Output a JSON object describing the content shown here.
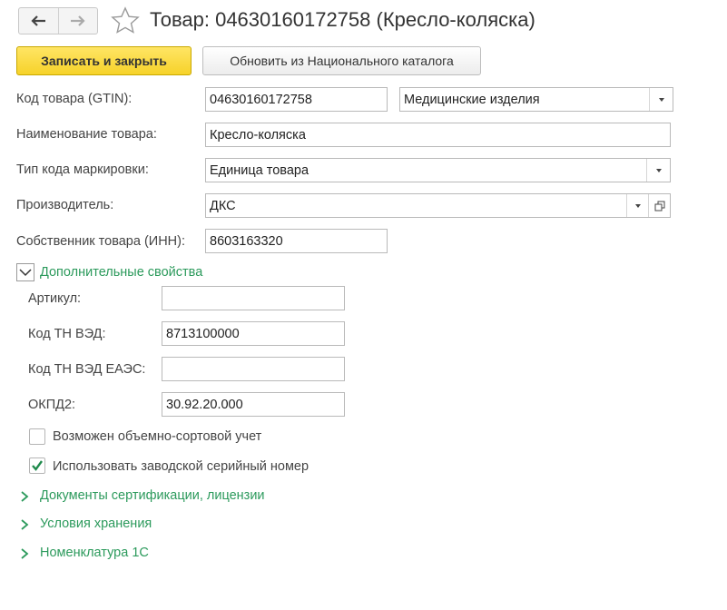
{
  "window": {
    "title": "Товар: 04630160172758 (Кресло-коляска)"
  },
  "toolbar": {
    "save_close_label": "Записать и закрыть",
    "update_label": "Обновить из Национального каталога"
  },
  "fields": {
    "gtin": {
      "label": "Код товара (GTIN):",
      "value": "04630160172758",
      "category": "Медицинские изделия"
    },
    "name": {
      "label": "Наименование товара:",
      "value": "Кресло-коляска"
    },
    "marking_type": {
      "label": "Тип кода маркировки:",
      "value": "Единица товара"
    },
    "manufacturer": {
      "label": "Производитель:",
      "value": "ДКС"
    },
    "owner_inn": {
      "label": "Собственник товара (ИНН):",
      "value": "8603163320"
    }
  },
  "extra": {
    "header": "Дополнительные свойства",
    "article": {
      "label": "Артикул:",
      "value": ""
    },
    "tnved": {
      "label": "Код ТН ВЭД:",
      "value": "8713100000"
    },
    "tnved_eaes": {
      "label": "Код ТН ВЭД ЕАЭС:",
      "value": ""
    },
    "okpd2": {
      "label": "ОКПД2:",
      "value": "30.92.20.000"
    },
    "bulk_accounting": {
      "label": "Возможен объемно-сортовой учет",
      "checked": false
    },
    "factory_serial": {
      "label": "Использовать заводской серийный номер",
      "checked": true
    }
  },
  "sections": [
    {
      "label": "Документы сертификации, лицензии"
    },
    {
      "label": "Условия хранения"
    },
    {
      "label": "Номенклатура 1С"
    }
  ],
  "colors": {
    "accent_green": "#2c9a5c",
    "primary_button": "#f6d22a"
  }
}
